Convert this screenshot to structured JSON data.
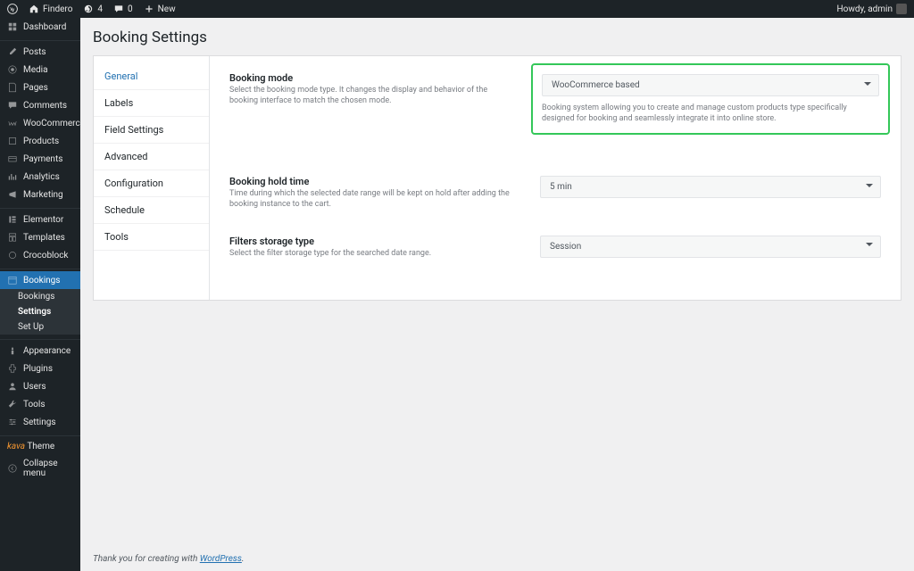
{
  "adminBar": {
    "siteName": "Findero",
    "updates": "4",
    "comments": "0",
    "new": "New",
    "greeting": "Howdy, admin"
  },
  "sidebar": {
    "items": [
      {
        "label": "Dashboard",
        "icon": "dashboard"
      },
      {
        "label": "Posts",
        "icon": "posts"
      },
      {
        "label": "Media",
        "icon": "media"
      },
      {
        "label": "Pages",
        "icon": "pages"
      },
      {
        "label": "Comments",
        "icon": "comments"
      },
      {
        "label": "WooCommerce",
        "icon": "woo"
      },
      {
        "label": "Products",
        "icon": "products"
      },
      {
        "label": "Payments",
        "icon": "payments"
      },
      {
        "label": "Analytics",
        "icon": "analytics"
      },
      {
        "label": "Marketing",
        "icon": "marketing"
      },
      {
        "label": "Elementor",
        "icon": "elementor"
      },
      {
        "label": "Templates",
        "icon": "templates"
      },
      {
        "label": "Crocoblock",
        "icon": "croco"
      },
      {
        "label": "Bookings",
        "icon": "bookings"
      },
      {
        "label": "Appearance",
        "icon": "appearance"
      },
      {
        "label": "Plugins",
        "icon": "plugins"
      },
      {
        "label": "Users",
        "icon": "users"
      },
      {
        "label": "Tools",
        "icon": "tools"
      },
      {
        "label": "Settings",
        "icon": "settings"
      }
    ],
    "submenu": [
      {
        "label": "Bookings"
      },
      {
        "label": "Settings"
      },
      {
        "label": "Set Up"
      }
    ],
    "kava": {
      "brand": "kava",
      "suffix": "Theme"
    },
    "collapse": "Collapse menu"
  },
  "page": {
    "title": "Booking Settings"
  },
  "tabs": [
    {
      "label": "General"
    },
    {
      "label": "Labels"
    },
    {
      "label": "Field Settings"
    },
    {
      "label": "Advanced"
    },
    {
      "label": "Configuration"
    },
    {
      "label": "Schedule"
    },
    {
      "label": "Tools"
    }
  ],
  "settings": {
    "mode": {
      "title": "Booking mode",
      "desc": "Select the booking mode type. It changes the display and behavior of the booking interface to match the chosen mode.",
      "value": "WooCommerce based",
      "help": "Booking system allowing you to create and manage custom products type specifically designed for booking and seamlessly integrate it into online store."
    },
    "hold": {
      "title": "Booking hold time",
      "desc": "Time during which the selected date range will be kept on hold after adding the booking instance to the cart.",
      "value": "5 min"
    },
    "storage": {
      "title": "Filters storage type",
      "desc": "Select the filter storage type for the searched date range.",
      "value": "Session"
    }
  },
  "footer": {
    "prefix": "Thank you for creating with ",
    "link": "WordPress",
    "suffix": "."
  }
}
